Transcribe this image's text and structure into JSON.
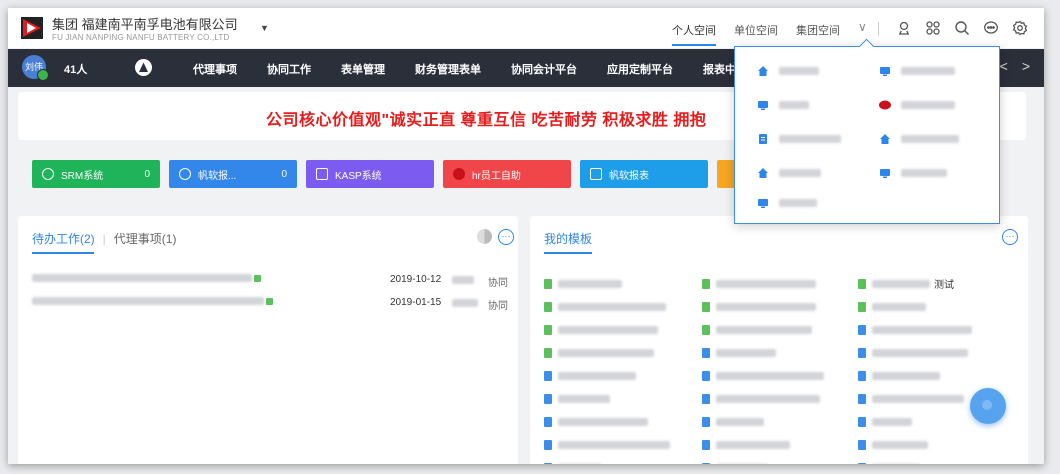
{
  "header": {
    "company_cn": "集团   福建南平南孚电池有限公司",
    "company_en": "FU JIAN NANPING NANFU BATTERY CO.,LTD",
    "space_tabs": [
      "个人空间",
      "单位空间",
      "集团空间"
    ],
    "icons": [
      "user-badge-icon",
      "apps-grid-icon",
      "search-icon",
      "message-icon",
      "settings-icon"
    ]
  },
  "nav": {
    "avatar_text": "刘伟",
    "online_count": "41人",
    "items": [
      "代理事项",
      "协同工作",
      "表单管理",
      "财务管理表单",
      "协同会计平台",
      "应用定制平台",
      "报表中心"
    ]
  },
  "banner": {
    "text": "公司核心价值观\"诚实正直 尊重互信 吃苦耐劳 积极求胜 拥抱"
  },
  "systems": [
    {
      "label": "SRM系统",
      "count": "0",
      "color": "#1fb45a"
    },
    {
      "label": "帆软报...",
      "count": "0",
      "color": "#3387ea"
    },
    {
      "label": "KASP系统",
      "count": "",
      "color": "#7c5cf0"
    },
    {
      "label": "hr员工自助",
      "count": "",
      "color": "#f0464a"
    },
    {
      "label": "帆软报表",
      "count": "",
      "color": "#1e9ee9"
    },
    {
      "label": "",
      "count": "",
      "color": "#f5a623"
    }
  ],
  "todo": {
    "tab_active": "待办工作(2)",
    "tab_other": "代理事项(1)",
    "rows": [
      {
        "date": "2019-10-12",
        "tag": "协同"
      },
      {
        "date": "2019-01-15",
        "tag": "协同"
      }
    ]
  },
  "templates": {
    "title": "我的模板",
    "last_visible_label": "测试"
  }
}
